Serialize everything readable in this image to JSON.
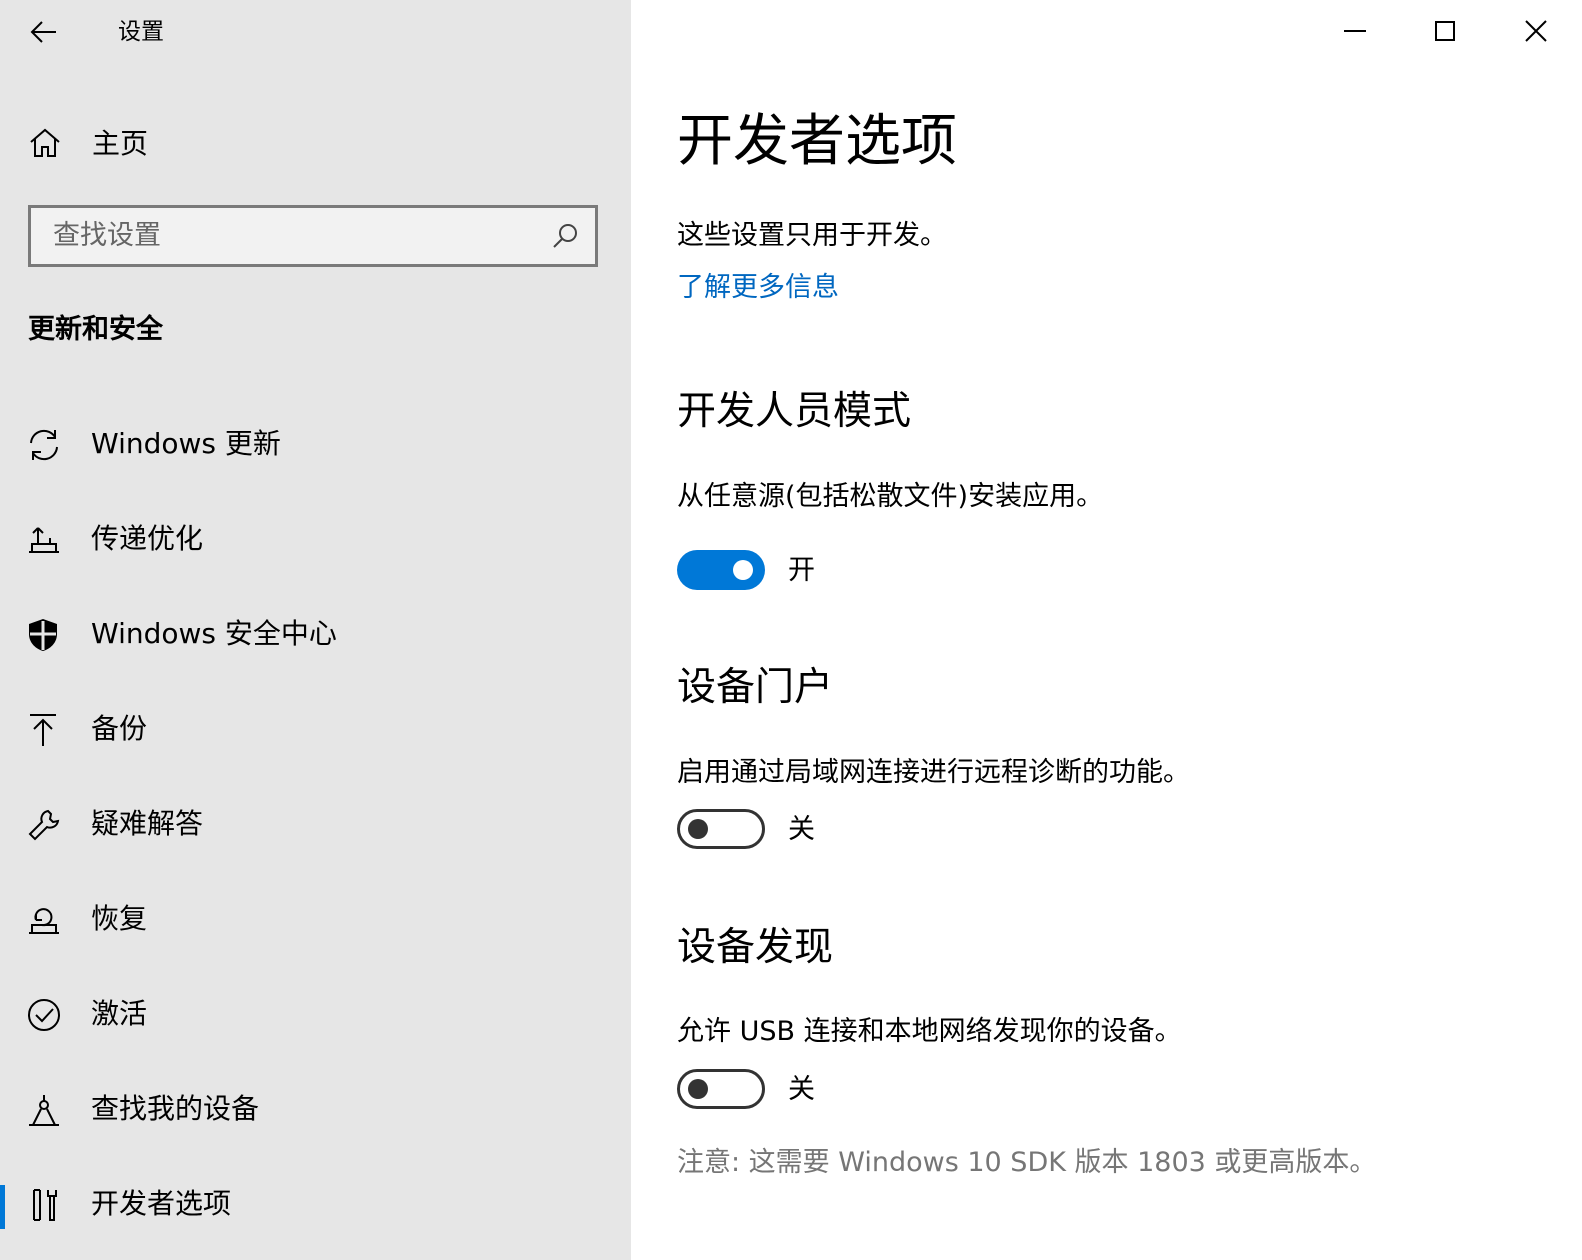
{
  "window": {
    "title": "设置",
    "controls": {
      "minimize": "minimize-icon",
      "maximize": "maximize-icon",
      "close": "close-icon"
    }
  },
  "sidebar": {
    "home_label": "主页",
    "search_placeholder": "查找设置",
    "section_title": "更新和安全",
    "items": [
      {
        "label": "Windows 更新",
        "icon": "sync-icon"
      },
      {
        "label": "传递优化",
        "icon": "delivery-optimization-icon"
      },
      {
        "label": "Windows 安全中心",
        "icon": "shield-icon"
      },
      {
        "label": "备份",
        "icon": "backup-arrow-icon"
      },
      {
        "label": "疑难解答",
        "icon": "wrench-icon"
      },
      {
        "label": "恢复",
        "icon": "recovery-icon"
      },
      {
        "label": "激活",
        "icon": "check-circle-icon"
      },
      {
        "label": "查找我的设备",
        "icon": "find-device-icon"
      },
      {
        "label": "开发者选项",
        "icon": "developer-tools-icon",
        "active": true
      }
    ]
  },
  "main": {
    "title": "开发者选项",
    "intro": "这些设置只用于开发。",
    "learn_more": "了解更多信息",
    "sections": [
      {
        "heading": "开发人员模式",
        "description": "从任意源(包括松散文件)安装应用。",
        "state": "开",
        "on": true
      },
      {
        "heading": "设备门户",
        "description": "启用通过局域网连接进行远程诊断的功能。",
        "state": "关",
        "on": false
      },
      {
        "heading": "设备发现",
        "description": "允许 USB 连接和本地网络发现你的设备。",
        "state": "关",
        "on": false
      }
    ],
    "note": "注意: 这需要 Windows 10 SDK 版本 1803 或更高版本。"
  },
  "colors": {
    "accent": "#0078d7",
    "link": "#0067c0",
    "sidebar_bg": "#e6e6e6",
    "note": "#767676"
  }
}
